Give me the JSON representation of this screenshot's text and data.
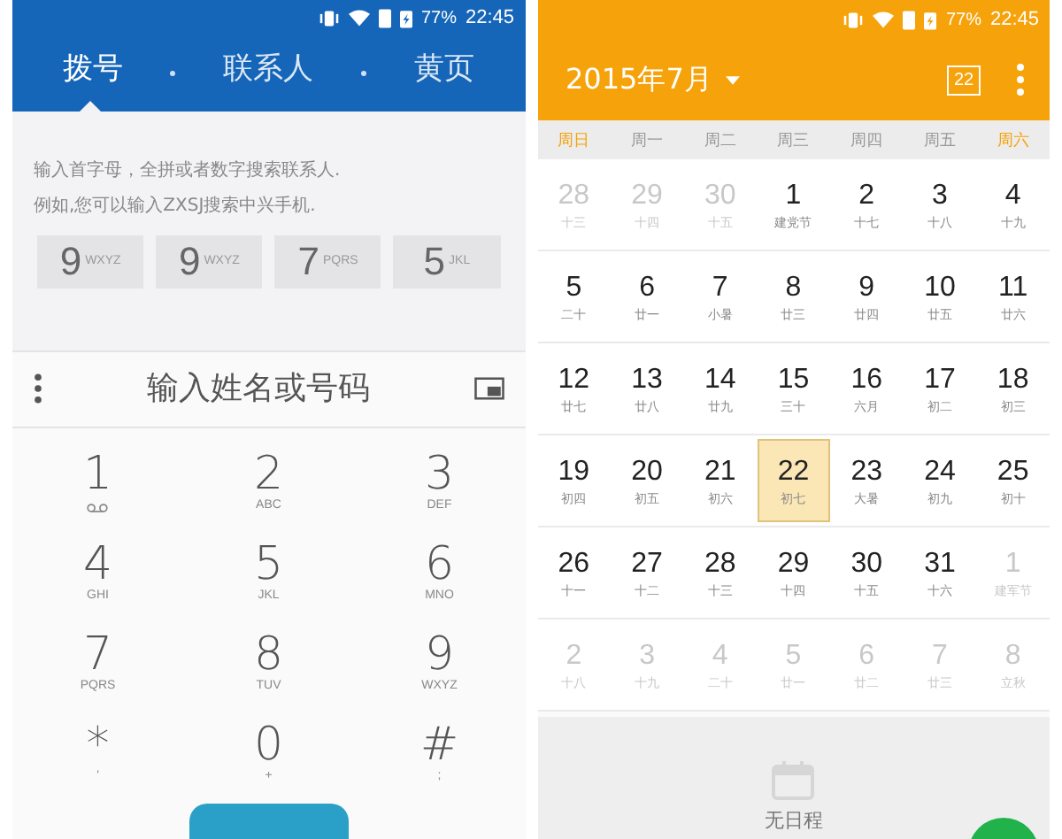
{
  "dialer": {
    "status_bar": {
      "battery": "77%",
      "time": "22:45"
    },
    "tabs": [
      {
        "label": "拨号",
        "selected": true
      },
      {
        "label": "联系人",
        "selected": false
      },
      {
        "label": "黄页",
        "selected": false
      }
    ],
    "hint_lines": [
      "输入首字母，全拼或者数字搜索联系人.",
      "例如,您可以输入ZXSJ搜索中兴手机."
    ],
    "suggestion_keys": [
      {
        "digit": "9",
        "letters": "WXYZ"
      },
      {
        "digit": "9",
        "letters": "WXYZ"
      },
      {
        "digit": "7",
        "letters": "PQRS"
      },
      {
        "digit": "5",
        "letters": "JKL"
      }
    ],
    "search": {
      "placeholder": "输入姓名或号码"
    },
    "keypad": [
      {
        "digit": "1",
        "kind": "voicemail"
      },
      {
        "digit": "2",
        "kind": "letters",
        "letters": "ABC"
      },
      {
        "digit": "3",
        "kind": "letters",
        "letters": "DEF"
      },
      {
        "digit": "4",
        "kind": "letters",
        "letters": "GHI"
      },
      {
        "digit": "5",
        "kind": "letters",
        "letters": "JKL"
      },
      {
        "digit": "6",
        "kind": "letters",
        "letters": "MNO"
      },
      {
        "digit": "7",
        "kind": "letters",
        "letters": "PQRS"
      },
      {
        "digit": "8",
        "kind": "letters",
        "letters": "TUV"
      },
      {
        "digit": "9",
        "kind": "letters",
        "letters": "WXYZ"
      },
      {
        "digit": "*",
        "kind": "letters",
        "letters": "'"
      },
      {
        "digit": "0",
        "kind": "letters",
        "letters": "+"
      },
      {
        "digit": "#",
        "kind": "letters",
        "letters": ";"
      }
    ]
  },
  "calendar": {
    "status_bar": {
      "battery": "77%",
      "time": "22:45"
    },
    "title": "2015年7月",
    "today_badge": "22",
    "weekdays": [
      {
        "label": "周日",
        "weekend": true
      },
      {
        "label": "周一",
        "weekend": false
      },
      {
        "label": "周二",
        "weekend": false
      },
      {
        "label": "周三",
        "weekend": false
      },
      {
        "label": "周四",
        "weekend": false
      },
      {
        "label": "周五",
        "weekend": false
      },
      {
        "label": "周六",
        "weekend": true
      }
    ],
    "weeks": [
      [
        {
          "day": "28",
          "lunar": "十三",
          "in_month": false,
          "selected": false
        },
        {
          "day": "29",
          "lunar": "十四",
          "in_month": false,
          "selected": false
        },
        {
          "day": "30",
          "lunar": "十五",
          "in_month": false,
          "selected": false
        },
        {
          "day": "1",
          "lunar": "建党节",
          "in_month": true,
          "selected": false
        },
        {
          "day": "2",
          "lunar": "十七",
          "in_month": true,
          "selected": false
        },
        {
          "day": "3",
          "lunar": "十八",
          "in_month": true,
          "selected": false
        },
        {
          "day": "4",
          "lunar": "十九",
          "in_month": true,
          "selected": false
        }
      ],
      [
        {
          "day": "5",
          "lunar": "二十",
          "in_month": true,
          "selected": false
        },
        {
          "day": "6",
          "lunar": "廿一",
          "in_month": true,
          "selected": false
        },
        {
          "day": "7",
          "lunar": "小暑",
          "in_month": true,
          "selected": false
        },
        {
          "day": "8",
          "lunar": "廿三",
          "in_month": true,
          "selected": false
        },
        {
          "day": "9",
          "lunar": "廿四",
          "in_month": true,
          "selected": false
        },
        {
          "day": "10",
          "lunar": "廿五",
          "in_month": true,
          "selected": false
        },
        {
          "day": "11",
          "lunar": "廿六",
          "in_month": true,
          "selected": false
        }
      ],
      [
        {
          "day": "12",
          "lunar": "廿七",
          "in_month": true,
          "selected": false
        },
        {
          "day": "13",
          "lunar": "廿八",
          "in_month": true,
          "selected": false
        },
        {
          "day": "14",
          "lunar": "廿九",
          "in_month": true,
          "selected": false
        },
        {
          "day": "15",
          "lunar": "三十",
          "in_month": true,
          "selected": false
        },
        {
          "day": "16",
          "lunar": "六月",
          "in_month": true,
          "selected": false
        },
        {
          "day": "17",
          "lunar": "初二",
          "in_month": true,
          "selected": false
        },
        {
          "day": "18",
          "lunar": "初三",
          "in_month": true,
          "selected": false
        }
      ],
      [
        {
          "day": "19",
          "lunar": "初四",
          "in_month": true,
          "selected": false
        },
        {
          "day": "20",
          "lunar": "初五",
          "in_month": true,
          "selected": false
        },
        {
          "day": "21",
          "lunar": "初六",
          "in_month": true,
          "selected": false
        },
        {
          "day": "22",
          "lunar": "初七",
          "in_month": true,
          "selected": true
        },
        {
          "day": "23",
          "lunar": "大暑",
          "in_month": true,
          "selected": false
        },
        {
          "day": "24",
          "lunar": "初九",
          "in_month": true,
          "selected": false
        },
        {
          "day": "25",
          "lunar": "初十",
          "in_month": true,
          "selected": false
        }
      ],
      [
        {
          "day": "26",
          "lunar": "十一",
          "in_month": true,
          "selected": false
        },
        {
          "day": "27",
          "lunar": "十二",
          "in_month": true,
          "selected": false
        },
        {
          "day": "28",
          "lunar": "十三",
          "in_month": true,
          "selected": false
        },
        {
          "day": "29",
          "lunar": "十四",
          "in_month": true,
          "selected": false
        },
        {
          "day": "30",
          "lunar": "十五",
          "in_month": true,
          "selected": false
        },
        {
          "day": "31",
          "lunar": "十六",
          "in_month": true,
          "selected": false
        },
        {
          "day": "1",
          "lunar": "建军节",
          "in_month": false,
          "selected": false
        }
      ],
      [
        {
          "day": "2",
          "lunar": "十八",
          "in_month": false,
          "selected": false
        },
        {
          "day": "3",
          "lunar": "十九",
          "in_month": false,
          "selected": false
        },
        {
          "day": "4",
          "lunar": "二十",
          "in_month": false,
          "selected": false
        },
        {
          "day": "5",
          "lunar": "廿一",
          "in_month": false,
          "selected": false
        },
        {
          "day": "6",
          "lunar": "廿二",
          "in_month": false,
          "selected": false
        },
        {
          "day": "7",
          "lunar": "廿三",
          "in_month": false,
          "selected": false
        },
        {
          "day": "8",
          "lunar": "立秋",
          "in_month": false,
          "selected": false
        }
      ]
    ],
    "agenda": {
      "empty_text": "无日程"
    }
  }
}
